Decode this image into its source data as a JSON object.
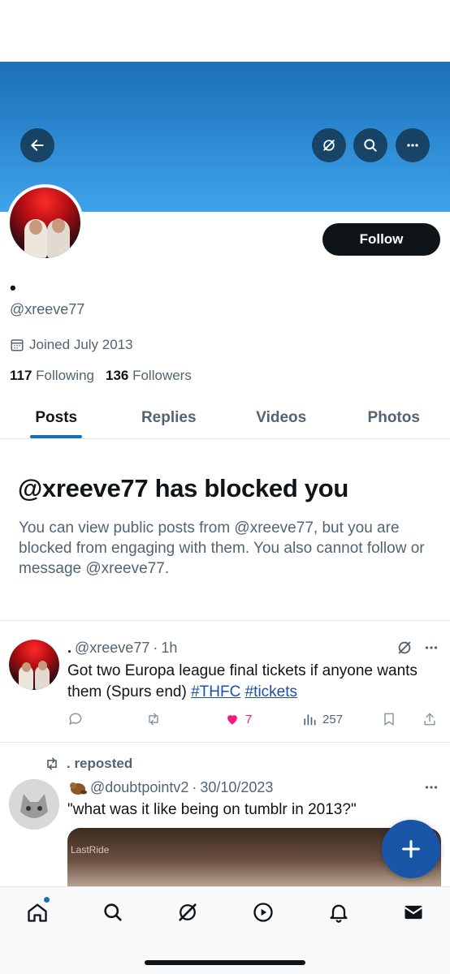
{
  "profile": {
    "display_name": "•",
    "handle": "@xreeve77",
    "joined": "Joined July 2013",
    "following_count": "117",
    "following_label": "Following",
    "followers_count": "136",
    "followers_label": "Followers",
    "follow_label": "Follow"
  },
  "tabs": [
    {
      "label": "Posts",
      "active": true
    },
    {
      "label": "Replies",
      "active": false
    },
    {
      "label": "Videos",
      "active": false
    },
    {
      "label": "Photos",
      "active": false
    }
  ],
  "blocked": {
    "title": "@xreeve77 has blocked you",
    "message": "You can view public posts from @xreeve77, but you are blocked from engaging with them. You also cannot follow or message @xreeve77."
  },
  "post1": {
    "name": ".",
    "handle": "@xreeve77",
    "time": "1h",
    "text_main": "Got two Europa league final tickets if anyone wants them (Spurs end)",
    "hashtag1": "#THFC",
    "hashtag2": "#tickets",
    "likes": "7",
    "views": "257"
  },
  "post2": {
    "repost_label": ". reposted",
    "handle": "@doubtpointv2",
    "date": "30/10/2023",
    "text": "\"what was it like being on tumblr in 2013?\"",
    "media_label": "LastRide"
  },
  "colors": {
    "accent": "#1d6fb5",
    "like": "#f91880",
    "fab": "#1a56a8"
  }
}
